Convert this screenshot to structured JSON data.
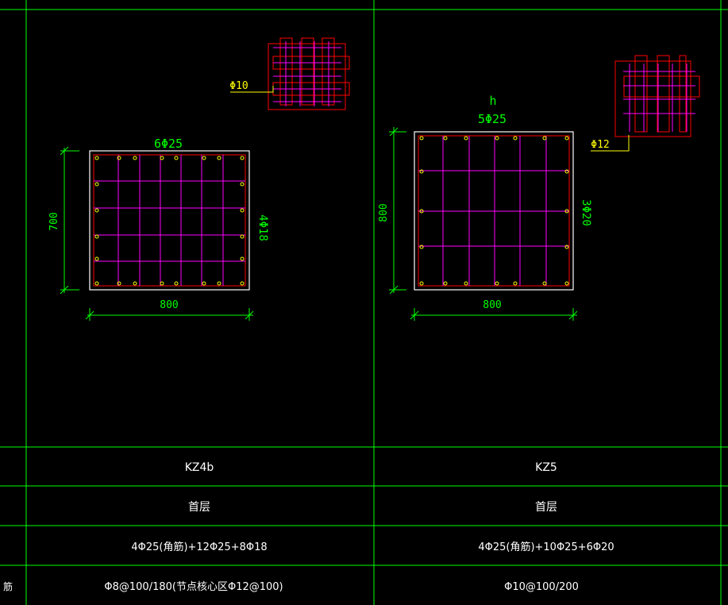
{
  "colors": {
    "grid": "#00ff00",
    "section": "#ffffff",
    "stirrup": "#ff00ff",
    "dim": "#00ff00",
    "leader": "#ffff00",
    "outline_red": "#ff0000",
    "bar": "#ffff00",
    "label": "#ffffff"
  },
  "left_column": {
    "dim_width": "800",
    "dim_height": "700",
    "top_bars": "6Φ25",
    "side_bars": "4Φ18",
    "tie_label": "Φ10"
  },
  "right_column": {
    "h_label": "h",
    "top_bars": "5Φ25",
    "dim_width": "800",
    "dim_height": "800",
    "side_bars": "3Φ20",
    "tie_label": "Φ12"
  },
  "table": {
    "names": [
      "KZ4b",
      "KZ5"
    ],
    "floors": [
      "首层",
      "首层"
    ],
    "longitudinal": [
      "4Φ25(角筋)+12Φ25+8Φ18",
      "4Φ25(角筋)+10Φ25+6Φ20"
    ],
    "stirrups": [
      "Φ8@100/180(节点核心区Φ12@100)",
      "Φ10@100/200"
    ],
    "left_stub": "筋"
  }
}
